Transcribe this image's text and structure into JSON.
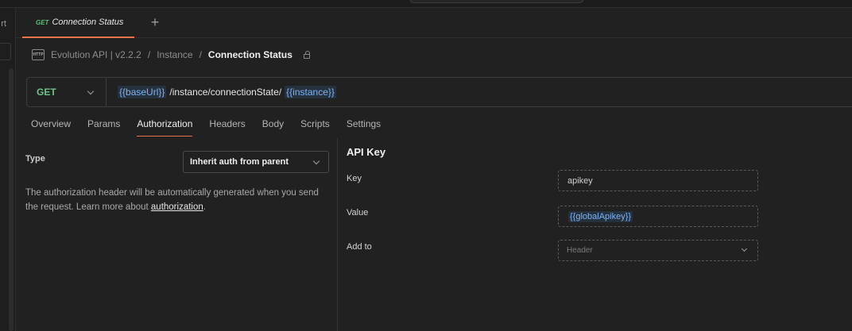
{
  "topbar": {
    "left_fragment": "rt"
  },
  "tabs": [
    {
      "method": "GET",
      "title": "Connection Status"
    }
  ],
  "new_tab_symbol": "+",
  "breadcrumb": {
    "collection": "Evolution API | v2.2.2",
    "separator": "/",
    "folder": "Instance",
    "current": "Connection Status"
  },
  "request": {
    "method": "GET",
    "url_parts": {
      "var1": "{{baseUrl}}",
      "path": "/instance/connectionState/",
      "var2": "{{instance}}"
    }
  },
  "request_tabs": [
    "Overview",
    "Params",
    "Authorization",
    "Headers",
    "Body",
    "Scripts",
    "Settings"
  ],
  "active_request_tab": "Authorization",
  "auth": {
    "type_label": "Type",
    "type_value": "Inherit auth from parent",
    "description": "The authorization header will be automatically generated when you send the request. Learn more about ",
    "description_link": "authorization",
    "description_end": ".",
    "section_title": "API Key",
    "key_label": "Key",
    "key_value": "apikey",
    "value_label": "Value",
    "value_value": "{{globalApikey}}",
    "addto_label": "Add to",
    "addto_value": "Header"
  },
  "colors": {
    "accent": "#e8744c",
    "get_method": "#6fc387",
    "variable": "#7fb2f0"
  },
  "icons": {
    "http": "http-icon",
    "lock": "lock-icon",
    "chevron": "chevron-down-icon",
    "plus": "plus-icon"
  }
}
